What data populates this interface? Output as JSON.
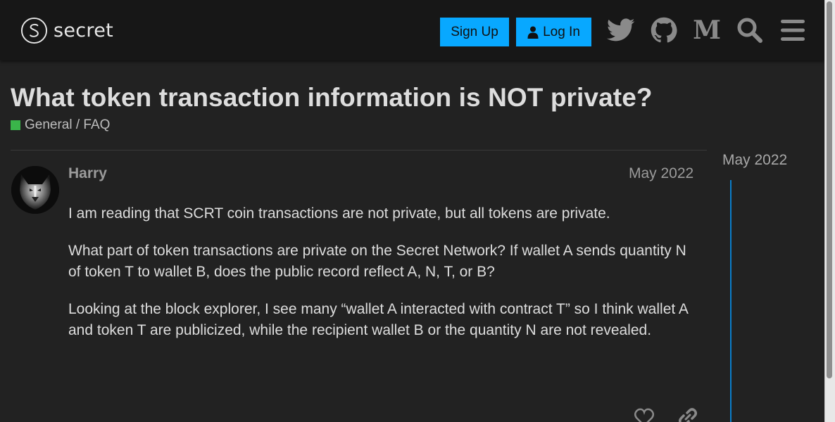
{
  "header": {
    "logo_text": "secret",
    "signup_label": "Sign Up",
    "login_label": "Log In",
    "icons": [
      "twitter-icon",
      "github-icon",
      "medium-icon",
      "search-icon",
      "hamburger-menu-icon"
    ]
  },
  "topic": {
    "title": "What token transaction information is NOT private?",
    "category": "General / FAQ",
    "category_color": "#3ab54a"
  },
  "post": {
    "username": "Harry",
    "date": "May 2022",
    "paragraphs": [
      "I am reading that SCRT coin transactions are not private, but all tokens are private.",
      "What part of token transactions are private on the Secret Network? If wallet A sends quantity N of token T to wallet B, does the public record reflect A, N, T, or B?",
      "Looking at the block explorer, I see many “wallet A interacted with contract T” so I think wallet A and token T are publicized, while the recipient wallet B or the quantity N are not revealed."
    ],
    "actions": [
      "like-icon",
      "link-icon"
    ]
  },
  "timeline": {
    "date": "May 2022"
  },
  "colors": {
    "accent": "#08a8ff",
    "background": "#222222",
    "header": "#171717",
    "timeline": "#0a7dca"
  }
}
